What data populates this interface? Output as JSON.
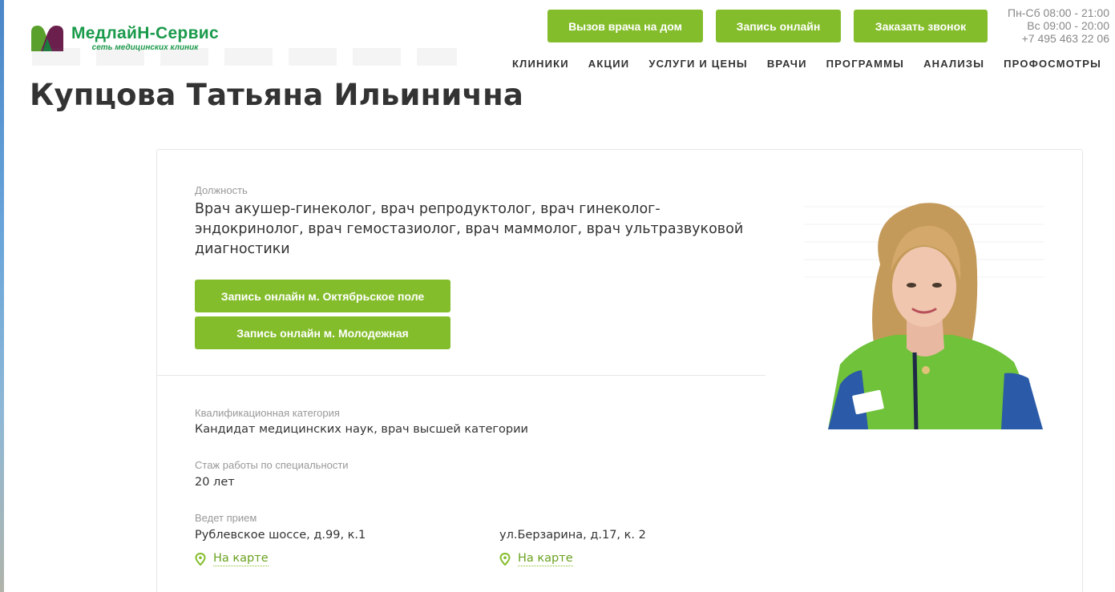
{
  "header": {
    "logo": {
      "title": "МедлайН-Сервис",
      "subtitle": "сеть медицинских клиник"
    },
    "buttons": {
      "house_call": "Вызов врача на дом",
      "online_booking": "Запись онлайн",
      "callback": "Заказать звонок"
    },
    "contacts": {
      "hours_weekdays": "Пн-Сб 08:00 - 21:00",
      "hours_sunday": "Вс 09:00 - 20:00",
      "phone": "+7 495 463 22 06"
    },
    "nav": [
      "КЛИНИКИ",
      "АКЦИИ",
      "УСЛУГИ И ЦЕНЫ",
      "ВРАЧИ",
      "ПРОГРАММЫ",
      "АНАЛИЗЫ",
      "ПРОФОСМОТРЫ"
    ]
  },
  "doctor": {
    "name": "Купцова Татьяна Ильинична",
    "position_label": "Должность",
    "position": "Врач акушер-гинеколог, врач репродуктолог, врач гинеколог-эндокринолог, врач гемостазиолог, врач маммолог, врач ультразвуковой диагностики",
    "booking_buttons": [
      "Запись онлайн м. Октябрьское поле",
      "Запись онлайн м. Молодежная"
    ],
    "qualification_label": "Квалификационная категория",
    "qualification": "Кандидат медицинских наук, врач высшей категории",
    "experience_label": "Стаж работы по специальности",
    "experience": "20 лет",
    "reception_label": "Ведет прием",
    "locations": [
      {
        "address": "Рублевское шоссе, д.99, к.1",
        "map_link": "На карте"
      },
      {
        "address": "ул.Берзарина, д.17, к. 2",
        "map_link": "На карте"
      }
    ]
  },
  "colors": {
    "accent": "#84bd2b",
    "brand": "#1a9a4b",
    "text": "#333333",
    "muted": "#999999"
  }
}
